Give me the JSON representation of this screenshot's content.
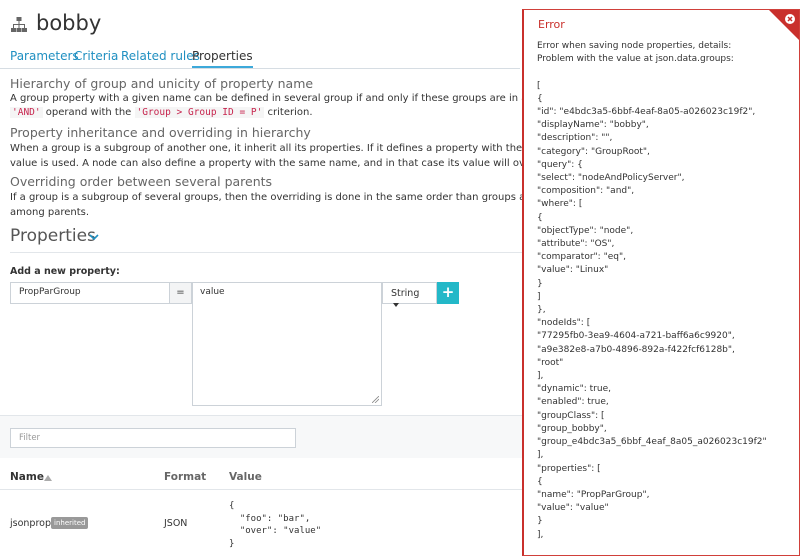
{
  "header": {
    "title": "bobby"
  },
  "tabs": [
    {
      "label": "Parameters"
    },
    {
      "label": "Criteria"
    },
    {
      "label": "Related rules"
    },
    {
      "label": "Properties"
    }
  ],
  "doc": {
    "h1": "Hierarchy of group and unicity of property name",
    "p1_line1": "A group property with a given name can be defined in several group if and only if these groups are in a sub-group hierarchi",
    "p1_code1": "'AND'",
    "p1_mid": " operand with the ",
    "p1_code2": "'Group > Group ID = P'",
    "p1_end": " criterion.",
    "h2": "Property inheritance and overriding in hierarchy",
    "p2_line1": "When a group is a subgroup of another one, it inherit all its properties. If it defines a property with the same name than a p",
    "p2_line2": "value is used. A node can also define a property with the same name, and in that case its value will override any group's val",
    "h3": "Overriding order between several parents",
    "p3_line1": "If a group is a subgroup of several groups, then the overriding is done in the same order than groups are defined in criteria",
    "p3_line2": "among parents."
  },
  "properties": {
    "title": "Properties",
    "add_label": "Add a new property:",
    "name_value": "PropParGroup",
    "eq": "=",
    "value_value": "value",
    "format_label": "String",
    "add_button": "+",
    "filter_placeholder": "Filter"
  },
  "table": {
    "headers": {
      "name": "Name",
      "format": "Format",
      "value": "Value"
    },
    "rows": [
      {
        "name": "jsonprop",
        "badge": "inherited",
        "format": "JSON",
        "value": "{\n  \"foo\": \"bar\",\n  \"over\": \"value\"\n}"
      }
    ]
  },
  "error": {
    "title": "Error",
    "body": "Error when saving node properties, details:\nProblem with the value at json.data.groups:\n\n[\n{\n\"id\": \"e4bdc3a5-6bbf-4eaf-8a05-a026023c19f2\",\n\"displayName\": \"bobby\",\n\"description\": \"\",\n\"category\": \"GroupRoot\",\n\"query\": {\n\"select\": \"nodeAndPolicyServer\",\n\"composition\": \"and\",\n\"where\": [\n{\n\"objectType\": \"node\",\n\"attribute\": \"OS\",\n\"comparator\": \"eq\",\n\"value\": \"Linux\"\n}\n]\n},\n\"nodeIds\": [\n\"77295fb0-3ea9-4604-a721-baff6a6c9920\",\n\"a9e382e8-a7b0-4896-892a-f422fcf6128b\",\n\"root\"\n],\n\"dynamic\": true,\n\"enabled\": true,\n\"groupClass\": [\n\"group_bobby\",\n\"group_e4bdc3a5_6bbf_4eaf_8a05_a026023c19f2\"\n],\n\"properties\": [\n{\n\"name\": \"PropParGroup\",\n\"value\": \"value\"\n}\n],"
  },
  "colors": {
    "accent": "#1f8fc1",
    "add_button": "#23b8c8",
    "error": "#c9302c",
    "badge": "#999999"
  },
  "icons": [
    "tree-icon",
    "chevron-down-icon",
    "caret-down-icon",
    "resize-grip-icon",
    "sort-up-icon",
    "close-icon"
  ]
}
